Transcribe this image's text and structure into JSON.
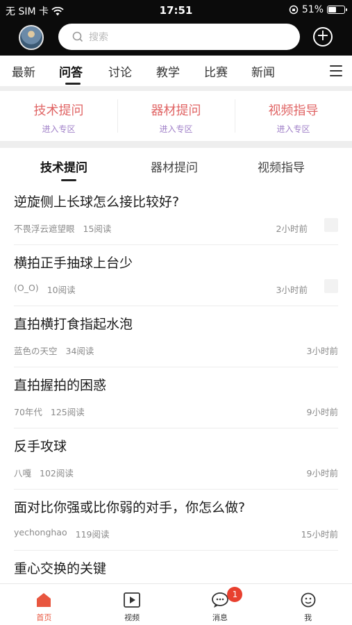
{
  "status_bar": {
    "carrier": "无 SIM 卡",
    "time": "17:51",
    "battery": "51%",
    "battery_level": 0.51
  },
  "top_bar": {
    "search_placeholder": "搜索"
  },
  "nav_tabs": [
    {
      "label": "最新"
    },
    {
      "label": "问答"
    },
    {
      "label": "讨论"
    },
    {
      "label": "教学"
    },
    {
      "label": "比赛"
    },
    {
      "label": "新闻"
    }
  ],
  "active_nav_tab": "问答",
  "zones": [
    {
      "title": "技术提问",
      "sub": "进入专区"
    },
    {
      "title": "器材提问",
      "sub": "进入专区"
    },
    {
      "title": "视频指导",
      "sub": "进入专区"
    }
  ],
  "sub_tabs": [
    {
      "label": "技术提问"
    },
    {
      "label": "器材提问"
    },
    {
      "label": "视频指导"
    }
  ],
  "active_sub_tab": "技术提问",
  "posts": [
    {
      "title": "逆旋侧上长球怎么接比较好?",
      "author": "不畏浮云遮望眼",
      "reads": "15阅读",
      "time": "2小时前",
      "has_thumb": true
    },
    {
      "title": "横拍正手抽球上台少",
      "author": "(O_O)",
      "reads": "10阅读",
      "time": "3小时前",
      "has_thumb": true
    },
    {
      "title": "直拍横打食指起水泡",
      "author": "蓝色の天空",
      "reads": "34阅读",
      "time": "3小时前",
      "has_thumb": false
    },
    {
      "title": "直拍握拍的困惑",
      "author": "70年代",
      "reads": "125阅读",
      "time": "9小时前",
      "has_thumb": false
    },
    {
      "title": "反手攻球",
      "author": "八嘎",
      "reads": "102阅读",
      "time": "9小时前",
      "has_thumb": false
    },
    {
      "title": "面对比你强或比你弱的对手，你怎么做?",
      "author": "yechonghao",
      "reads": "119阅读",
      "time": "15小时前",
      "has_thumb": false
    },
    {
      "title": "重心交换的关键",
      "author": "",
      "reads": "",
      "time": "",
      "has_thumb": false
    }
  ],
  "bottom_nav": [
    {
      "label": "首页",
      "icon": "home-icon"
    },
    {
      "label": "视频",
      "icon": "video-icon"
    },
    {
      "label": "消息",
      "icon": "message-icon",
      "badge": "1"
    },
    {
      "label": "我",
      "icon": "profile-icon"
    }
  ],
  "colors": {
    "accent": "#e8563f",
    "zone_title": "#e06464",
    "zone_sub": "#a080c8",
    "badge": "#e8402f"
  }
}
